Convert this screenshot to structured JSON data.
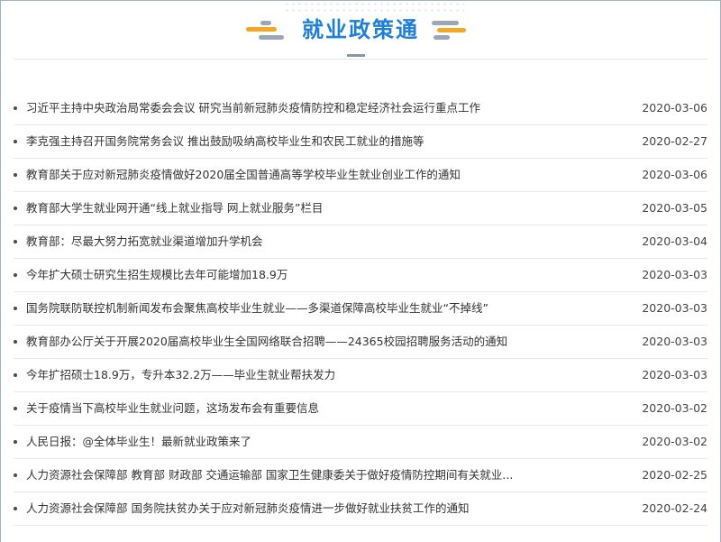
{
  "header": {
    "title": "就业政策通"
  },
  "news": [
    {
      "title": "习近平主持中央政治局常委会会议 研究当前新冠肺炎疫情防控和稳定经济社会运行重点工作",
      "date": "2020-03-06"
    },
    {
      "title": "李克强主持召开国务院常务会议 推出鼓励吸纳高校毕业生和农民工就业的措施等",
      "date": "2020-02-27"
    },
    {
      "title": "教育部关于应对新冠肺炎疫情做好2020届全国普通高等学校毕业生就业创业工作的通知",
      "date": "2020-03-06"
    },
    {
      "title": "教育部大学生就业网开通“线上就业指导 网上就业服务”栏目",
      "date": "2020-03-05"
    },
    {
      "title": "教育部：尽最大努力拓宽就业渠道增加升学机会",
      "date": "2020-03-04"
    },
    {
      "title": "今年扩大硕士研究生招生规模比去年可能增加18.9万",
      "date": "2020-03-03"
    },
    {
      "title": "国务院联防联控机制新闻发布会聚焦高校毕业生就业——多渠道保障高校毕业生就业“不掉线”",
      "date": "2020-03-03"
    },
    {
      "title": "教育部办公厅关于开展2020届高校毕业生全国网络联合招聘——24365校园招聘服务活动的通知",
      "date": "2020-03-03"
    },
    {
      "title": "今年扩招硕士18.9万，专升本32.2万——毕业生就业帮扶发力",
      "date": "2020-03-03"
    },
    {
      "title": "关于疫情当下高校毕业生就业问题，这场发布会有重要信息",
      "date": "2020-03-02"
    },
    {
      "title": "人民日报：@全体毕业生！最新就业政策来了",
      "date": "2020-03-02"
    },
    {
      "title": "人力资源社会保障部 教育部 财政部 交通运输部 国家卫生健康委关于做好疫情防控期间有关就业...",
      "date": "2020-02-25"
    },
    {
      "title": "人力资源社会保障部 国务院扶贫办关于应对新冠肺炎疫情进一步做好就业扶贫工作的通知",
      "date": "2020-02-24"
    }
  ]
}
